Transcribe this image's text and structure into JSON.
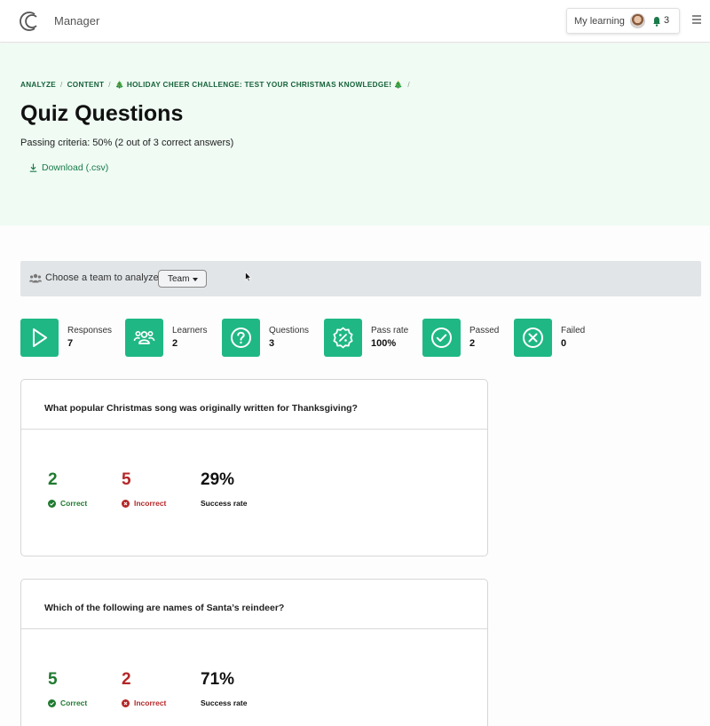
{
  "app": {
    "name": "Manager"
  },
  "topbar": {
    "my_learning": "My learning",
    "notifications": "3"
  },
  "breadcrumb": {
    "items": [
      "ANALYZE",
      "CONTENT",
      "🎄 HOLIDAY CHEER CHALLENGE: TEST YOUR CHRISTMAS KNOWLEDGE! 🎄"
    ]
  },
  "page": {
    "title": "Quiz Questions",
    "criteria": "Passing criteria: 50% (2 out of 3 correct answers)",
    "download": "Download (.csv)"
  },
  "team": {
    "label": "Choose a team to analyze",
    "select_value": "Team"
  },
  "stats": [
    {
      "label": "Responses",
      "value": "7",
      "icon": "play-icon"
    },
    {
      "label": "Learners",
      "value": "2",
      "icon": "users-icon"
    },
    {
      "label": "Questions",
      "value": "3",
      "icon": "question-icon"
    },
    {
      "label": "Pass rate",
      "value": "100%",
      "icon": "percent-badge-icon"
    },
    {
      "label": "Passed",
      "value": "2",
      "icon": "check-circle-icon"
    },
    {
      "label": "Failed",
      "value": "0",
      "icon": "x-circle-icon"
    }
  ],
  "questions": [
    {
      "text": "What popular Christmas song was originally written for Thanksgiving?",
      "correct": "2",
      "incorrect": "5",
      "success_rate": "29%"
    },
    {
      "text": "Which of the following are names of Santa’s reindeer?",
      "correct": "5",
      "incorrect": "2",
      "success_rate": "71%"
    }
  ],
  "metric_labels": {
    "correct": "Correct",
    "incorrect": "Incorrect",
    "success_rate": "Success rate"
  },
  "colors": {
    "accent": "#1fb885",
    "correct": "#1f7a2f",
    "incorrect": "#b42727",
    "header_bg": "#effbf3"
  }
}
